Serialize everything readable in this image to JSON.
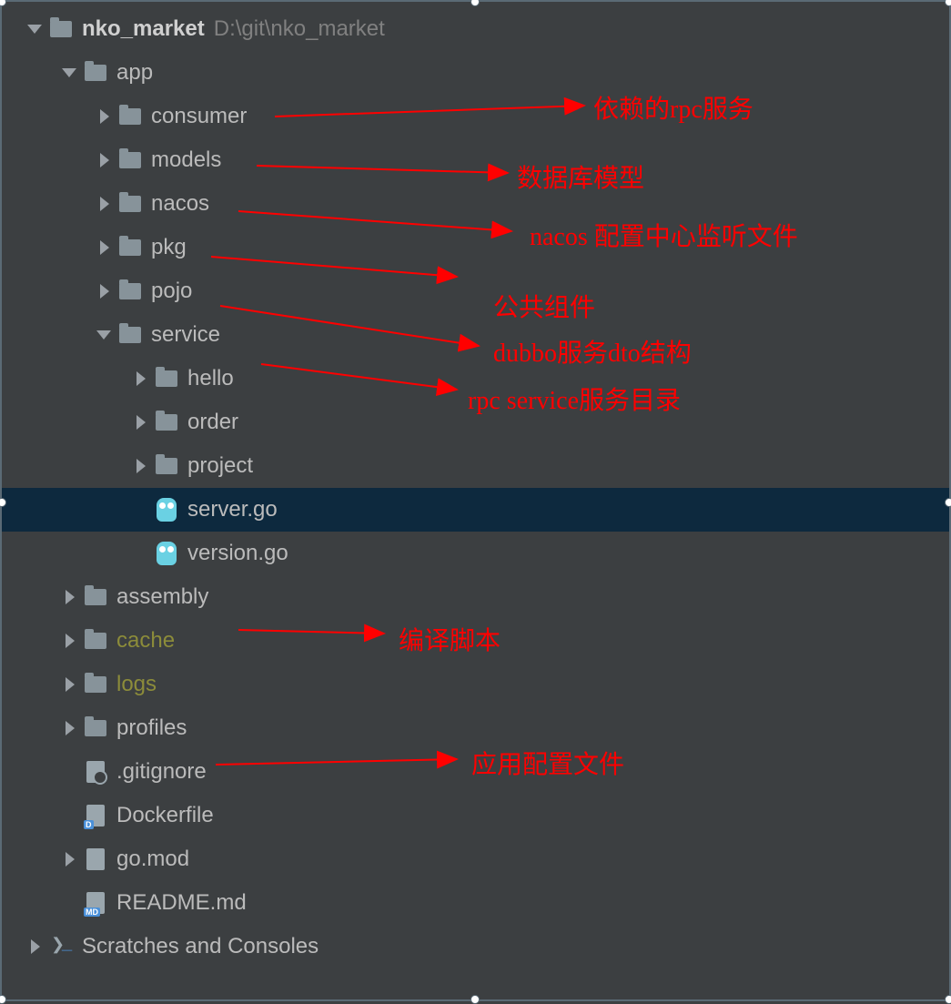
{
  "root": {
    "name": "nko_market",
    "path": "D:\\git\\nko_market"
  },
  "tree": {
    "app": "app",
    "consumer": "consumer",
    "models": "models",
    "nacos": "nacos",
    "pkg": "pkg",
    "pojo": "pojo",
    "service": "service",
    "hello": "hello",
    "order": "order",
    "project": "project",
    "server_go": "server.go",
    "version_go": "version.go",
    "assembly": "assembly",
    "cache": "cache",
    "logs": "logs",
    "profiles": "profiles",
    "gitignore": ".gitignore",
    "dockerfile": "Dockerfile",
    "gomod": "go.mod",
    "readme": "README.md"
  },
  "scratches": "Scratches and Consoles",
  "annotations": {
    "consumer": "依赖的rpc服务",
    "models": "数据库模型",
    "nacos": "nacos 配置中心监听文件",
    "pkg": "公共组件",
    "pojo": "dubbo服务dto结构",
    "service": "rpc service服务目录",
    "assembly": "编译脚本",
    "profiles": "应用配置文件"
  }
}
